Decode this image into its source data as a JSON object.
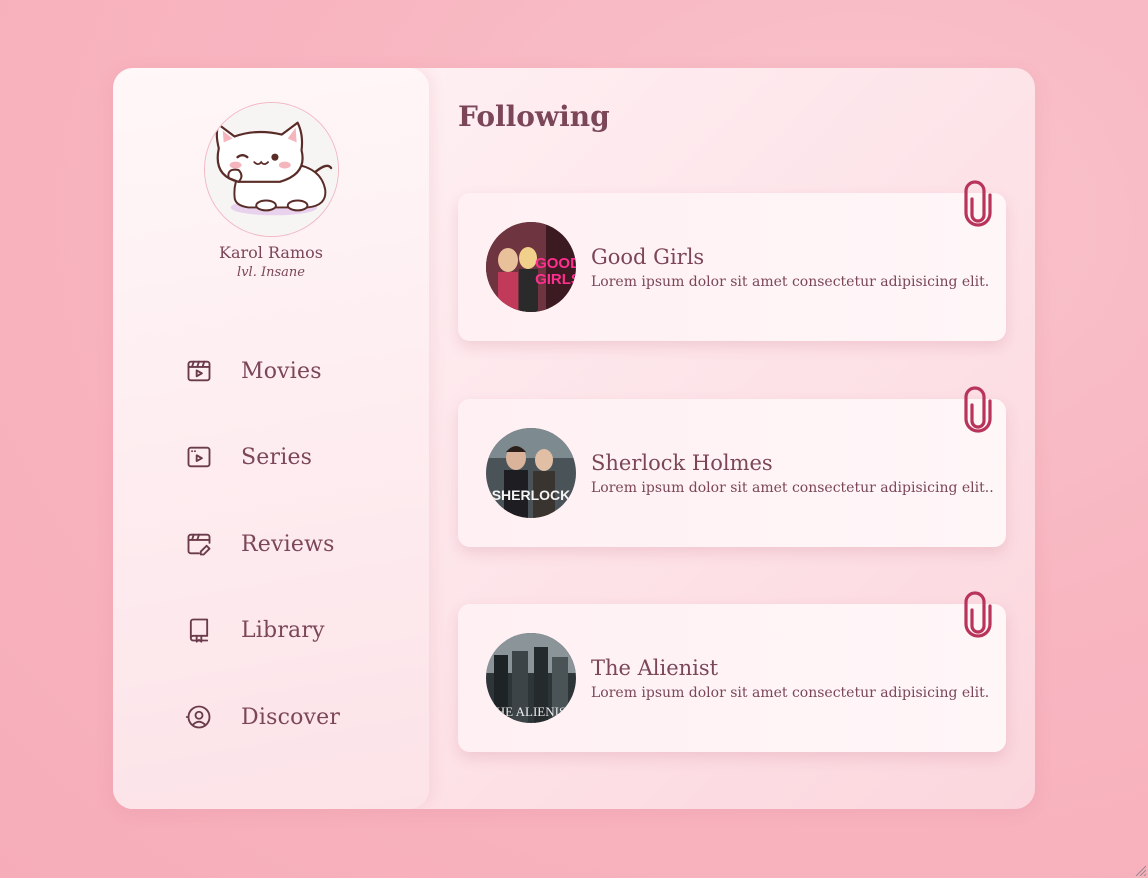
{
  "profile": {
    "name": "Karol Ramos",
    "level": "lvl. Insane",
    "avatar_icon": "cute-cat-avatar"
  },
  "sidebar": {
    "items": [
      {
        "label": "Movies",
        "icon": "movie-clapper-icon"
      },
      {
        "label": "Series",
        "icon": "video-play-icon"
      },
      {
        "label": "Reviews",
        "icon": "review-edit-icon"
      },
      {
        "label": "Library",
        "icon": "book-icon"
      },
      {
        "label": "Discover",
        "icon": "discover-user-icon"
      }
    ]
  },
  "main": {
    "heading": "Following",
    "cards": [
      {
        "title": "Good Girls",
        "description": "Lorem ipsum dolor sit amet consectetur adipisicing elit.",
        "thumbnail_text": "GOOD GIRLS"
      },
      {
        "title": "Sherlock Holmes",
        "description": "Lorem ipsum dolor sit amet consectetur adipisicing elit..",
        "thumbnail_text": "SHERLOCK"
      },
      {
        "title": "The Alienist",
        "description": "Lorem ipsum dolor sit amet consectetur adipisicing elit.",
        "thumbnail_text": "THE ALIENIST"
      }
    ]
  },
  "colors": {
    "background": "#f8b6c1",
    "text": "#7b4658",
    "accent": "#b8345a"
  }
}
